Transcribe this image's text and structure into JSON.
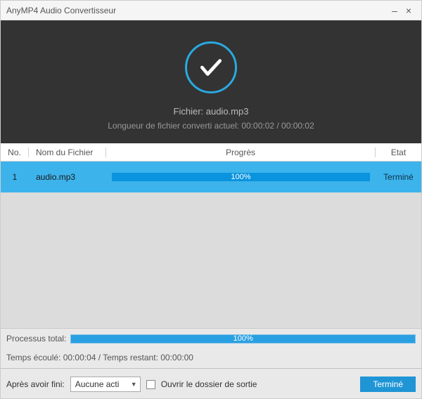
{
  "titlebar": {
    "title": "AnyMP4 Audio Convertisseur"
  },
  "header": {
    "file_label": "Fichier: audio.mp3",
    "length_label": "Longueur de fichier converti actuel: 00:00:02 / 00:00:02"
  },
  "columns": {
    "no": "No.",
    "name": "Nom du Fichier",
    "progress": "Progrès",
    "state": "Etat"
  },
  "rows": [
    {
      "no": "1",
      "name": "audio.mp3",
      "percent": "100%",
      "state": "Terminé"
    }
  ],
  "footer": {
    "total_label": "Processus total:",
    "total_percent": "100%",
    "time_line": "Temps écoulé: 00:00:04 / Temps restant: 00:00:00",
    "after_label": "Après avoir fini:",
    "after_option": "Aucune acti",
    "open_folder_label": "Ouvrir le dossier de sortie",
    "done_button": "Terminé"
  },
  "chart_data": {
    "type": "bar",
    "items": [
      {
        "label": "audio.mp3",
        "value": 100
      },
      {
        "label": "Processus total",
        "value": 100
      }
    ],
    "unit": "%",
    "range": [
      0,
      100
    ]
  }
}
